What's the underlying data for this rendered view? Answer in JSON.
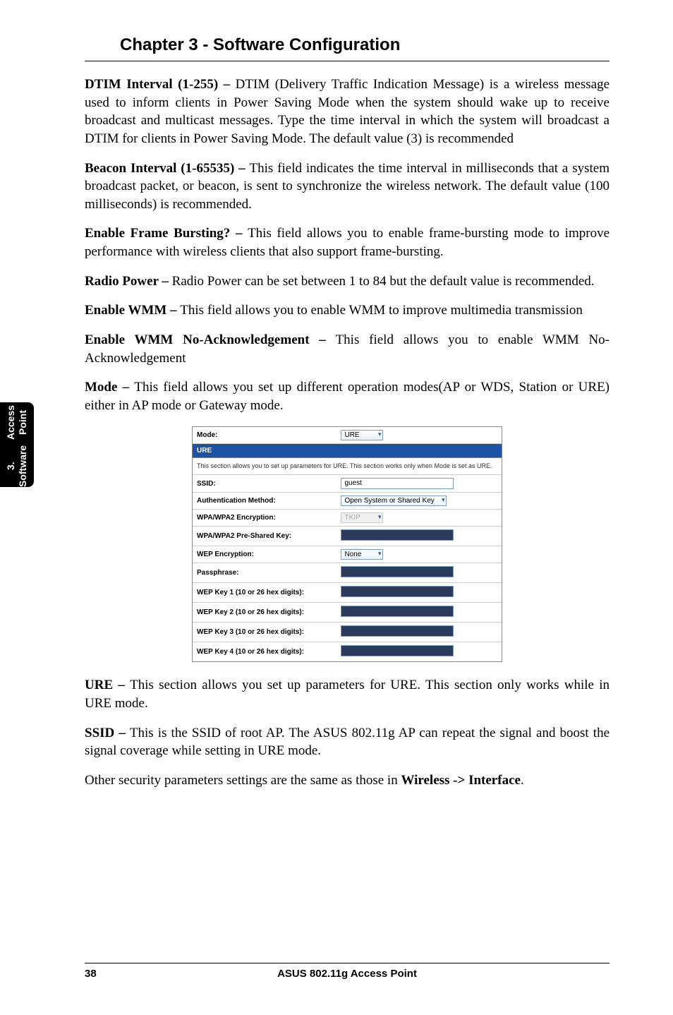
{
  "sideTab": {
    "line1": "3. Software",
    "line2": "Access Point"
  },
  "chapterTitle": "Chapter 3 - Software Configuration",
  "paragraphs": {
    "dtim": {
      "label": "DTIM Interval (1-255) – ",
      "text": "DTIM (Delivery Traffic Indication Message) is a wireless message used to inform clients in Power Saving Mode when the system should wake up to receive broadcast and multicast messages. Type the time interval in which the system will broadcast a DTIM for clients in Power Saving Mode. The default value (3) is recommended"
    },
    "beacon": {
      "label": "Beacon Interval (1-65535) – ",
      "text": "This field indicates the time interval in milliseconds that a system broadcast packet, or beacon, is sent to synchronize the wireless network. The default value (100 milliseconds) is recommended."
    },
    "frameBurst": {
      "label": "Enable Frame Bursting? – ",
      "text": "This field allows you to enable frame-bursting mode to improve performance with wireless clients that also support frame-bursting."
    },
    "radioPower": {
      "label": "Radio Power – ",
      "text": "Radio Power can be set between 1 to 84 but the default value is recommended."
    },
    "wmm": {
      "label": "Enable WMM – ",
      "text": "This field allows you to enable WMM to improve multimedia transmission"
    },
    "wmmNoAck": {
      "label": "Enable WMM No-Acknowledgement – ",
      "text": "This field allows you to enable WMM No-Acknowledgement"
    },
    "mode": {
      "label": "Mode – ",
      "text": "This field allows you set up different operation modes(AP or WDS, Station or URE) either in AP mode or Gateway mode."
    },
    "ure": {
      "label": "URE – ",
      "text": "This section allows you set up parameters for URE. This section only works while in URE mode."
    },
    "ssid": {
      "label": "SSID – ",
      "text": "This is the SSID of root AP. The ASUS 802.11g AP can repeat the signal and boost the signal coverage while setting in URE mode."
    },
    "other": {
      "pre": "Other security parameters settings are the same as those in ",
      "bold": "Wireless -> Interface",
      "post": "."
    }
  },
  "screenshot": {
    "modeLabel": "Mode:",
    "modeValue": "URE",
    "ureHeader": "URE",
    "ureDesc": "This section allows you to set up parameters for URE. This section works only when Mode is set as URE.",
    "rows": {
      "ssid": {
        "label": "SSID:",
        "value": "guest"
      },
      "auth": {
        "label": "Authentication Method:",
        "value": "Open System or Shared Key"
      },
      "wpaEnc": {
        "label": "WPA/WPA2 Encryption:",
        "value": "TKIP"
      },
      "wpaPsk": {
        "label": "WPA/WPA2 Pre-Shared Key:"
      },
      "wepEnc": {
        "label": "WEP Encryption:",
        "value": "None"
      },
      "pass": {
        "label": "Passphrase:"
      },
      "wep1": {
        "label": "WEP Key 1 (10 or 26 hex digits):"
      },
      "wep2": {
        "label": "WEP Key 2 (10 or 26 hex digits):"
      },
      "wep3": {
        "label": "WEP Key 3 (10 or 26 hex digits):"
      },
      "wep4": {
        "label": "WEP Key 4 (10 or 26 hex digits):"
      }
    }
  },
  "footer": {
    "page": "38",
    "title": "ASUS 802.11g Access Point"
  }
}
